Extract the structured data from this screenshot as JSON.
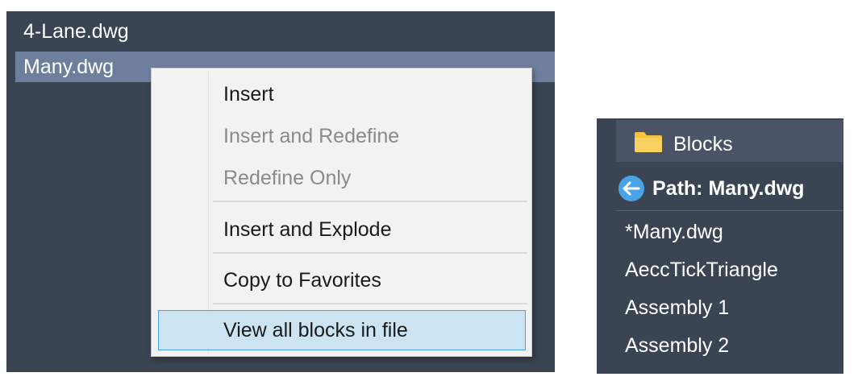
{
  "file_list": {
    "items": [
      {
        "label": "4-Lane.dwg"
      },
      {
        "label": "Many.dwg"
      }
    ]
  },
  "context_menu": {
    "items": [
      {
        "label": "Insert",
        "enabled": true
      },
      {
        "label": "Insert and Redefine",
        "enabled": false
      },
      {
        "label": "Redefine Only",
        "enabled": false
      },
      {
        "label": "Insert and Explode",
        "enabled": true
      },
      {
        "label": "Copy to Favorites",
        "enabled": true
      },
      {
        "label": "View all blocks in file",
        "enabled": true,
        "highlighted": true
      }
    ]
  },
  "blocks_panel": {
    "header_label": "Blocks",
    "header_icon": "folder-icon",
    "back_icon": "back-arrow-icon",
    "path_label": "Path: Many.dwg",
    "items": [
      {
        "label": "*Many.dwg"
      },
      {
        "label": "AeccTickTriangle"
      },
      {
        "label": "Assembly 1"
      },
      {
        "label": "Assembly 2"
      }
    ]
  },
  "colors": {
    "panel_bg": "#3b4453",
    "selected_row": "#6e7f9e",
    "menu_bg": "#f2f2f2",
    "menu_highlight": "#cce4f2",
    "menu_highlight_border": "#46a3d9",
    "folder": "#f5c242",
    "back_icon": "#4aa3e6"
  }
}
